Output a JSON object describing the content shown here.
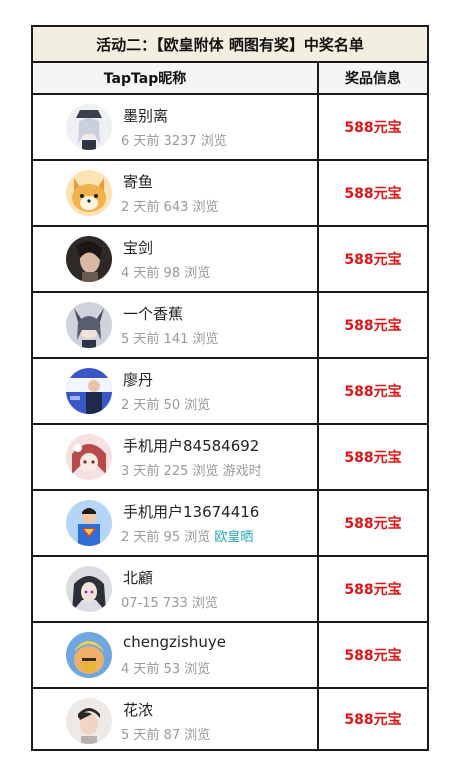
{
  "title": "活动二：【欧皇附体 晒图有奖】中奖名单",
  "columns": {
    "nickname": "TapTap昵称",
    "prize": "奖品信息"
  },
  "rows": [
    {
      "name": "墨别离",
      "time": "6 天前",
      "views": "3237 浏览",
      "extra": "",
      "tag": "",
      "prize": "588元宝",
      "avatar_icon": "anime-girl-avatar-icon",
      "avatar_color": "#9aa3b5"
    },
    {
      "name": "寄鱼",
      "time": "2 天前",
      "views": "643 浏览",
      "extra": "",
      "tag": "",
      "prize": "588元宝",
      "avatar_icon": "shiba-dog-avatar-icon",
      "avatar_color": "#f0b24c"
    },
    {
      "name": "宝剑",
      "time": "4 天前",
      "views": "98 浏览",
      "extra": "",
      "tag": "",
      "prize": "588元宝",
      "avatar_icon": "woman-photo-avatar-icon",
      "avatar_color": "#6b5a52"
    },
    {
      "name": "一个香蕉",
      "time": "5 天前",
      "views": "141 浏览",
      "extra": "",
      "tag": "",
      "prize": "588元宝",
      "avatar_icon": "anime-character-avatar-icon",
      "avatar_color": "#5a5f70"
    },
    {
      "name": "廖丹",
      "time": "2 天前",
      "views": "50 浏览",
      "extra": "",
      "tag": "",
      "prize": "588元宝",
      "avatar_icon": "man-banner-avatar-icon",
      "avatar_color": "#3a57c9"
    },
    {
      "name": "手机用户84584692",
      "time": "3 天前",
      "views": "225 浏览",
      "extra": "游戏时",
      "tag": "",
      "prize": "588元宝",
      "avatar_icon": "anime-redhair-avatar-icon",
      "avatar_color": "#c95a5a"
    },
    {
      "name": "手机用户13674416",
      "time": "2 天前",
      "views": "95 浏览",
      "extra": "",
      "tag": "欧皇晒",
      "prize": "588元宝",
      "avatar_icon": "superman-avatar-icon",
      "avatar_color": "#2d6fd6"
    },
    {
      "name": "北顧",
      "time": "07-15",
      "views": "733 浏览",
      "extra": "",
      "tag": "",
      "prize": "588元宝",
      "avatar_icon": "anime-darkhair-avatar-icon",
      "avatar_color": "#3c3f4a"
    },
    {
      "name": "chengzishuye",
      "time": "4 天前",
      "views": "53 浏览",
      "extra": "",
      "tag": "",
      "prize": "588元宝",
      "avatar_icon": "clash-barbarian-avatar-icon",
      "avatar_color": "#e0a02a"
    },
    {
      "name": "花浓",
      "time": "5 天前",
      "views": "87 浏览",
      "extra": "",
      "tag": "",
      "prize": "588元宝",
      "avatar_icon": "boy-portrait-avatar-icon",
      "avatar_color": "#d8d4d0"
    }
  ]
}
